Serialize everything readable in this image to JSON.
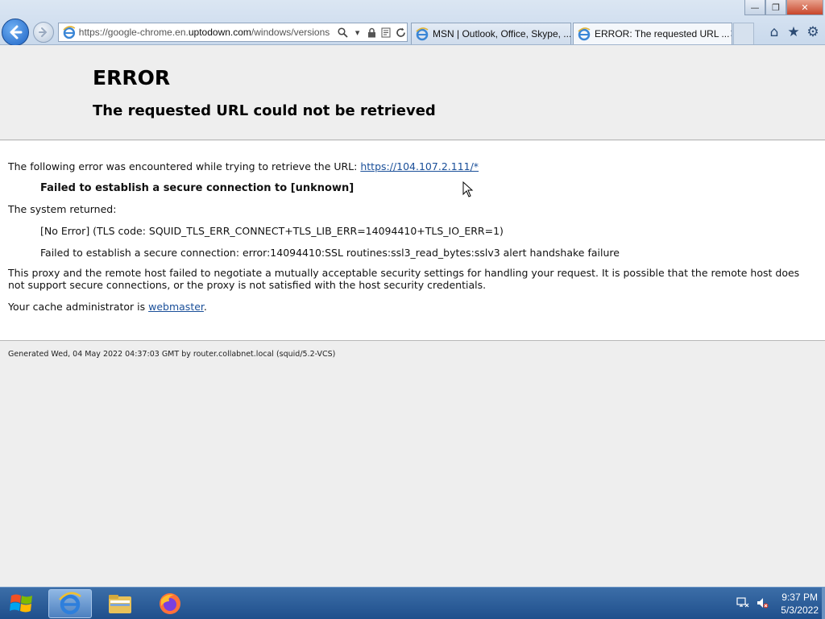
{
  "window": {
    "controls": {
      "minimize": "—",
      "restore": "❐",
      "close": "✕"
    }
  },
  "browser": {
    "address": {
      "url_prefix": "https://google-chrome.en.",
      "url_domain": "uptodown.com",
      "url_suffix": "/windows/versions"
    },
    "tabs": [
      {
        "label": "MSN | Outlook, Office, Skype, ...",
        "active": false
      },
      {
        "label": "ERROR: The requested URL ...",
        "active": true
      }
    ],
    "tools": {
      "home": "⌂",
      "favorites": "★",
      "settings": "⚙"
    }
  },
  "page": {
    "title": "ERROR",
    "subtitle": "The requested URL could not be retrieved",
    "intro_text": "The following error was encountered while trying to retrieve the URL: ",
    "intro_link": "https://104.107.2.111/*",
    "failed_line": "Failed to establish a secure connection to [unknown]",
    "system_returned": "The system returned:",
    "error_code": "[No Error] (TLS code: SQUID_TLS_ERR_CONNECT+TLS_LIB_ERR=14094410+TLS_IO_ERR=1)",
    "error_detail": "Failed to establish a secure connection: error:14094410:SSL routines:ssl3_read_bytes:sslv3 alert handshake failure",
    "paragraph": "This proxy and the remote host failed to negotiate a mutually acceptable security settings for handling your request. It is possible that the remote host does not support secure connections, or the proxy is not satisfied with the host security credentials.",
    "admin_text": "Your cache administrator is ",
    "admin_link": "webmaster",
    "admin_suffix": ".",
    "footer": "Generated Wed, 04 May 2022 04:37:03 GMT by router.collabnet.local (squid/5.2-VCS)"
  },
  "taskbar": {
    "time": "9:37 PM",
    "date": "5/3/2022"
  },
  "colors": {
    "link": "#1a4f99",
    "taskbar": "#2a5a96",
    "page_bg": "#eeeeee"
  }
}
